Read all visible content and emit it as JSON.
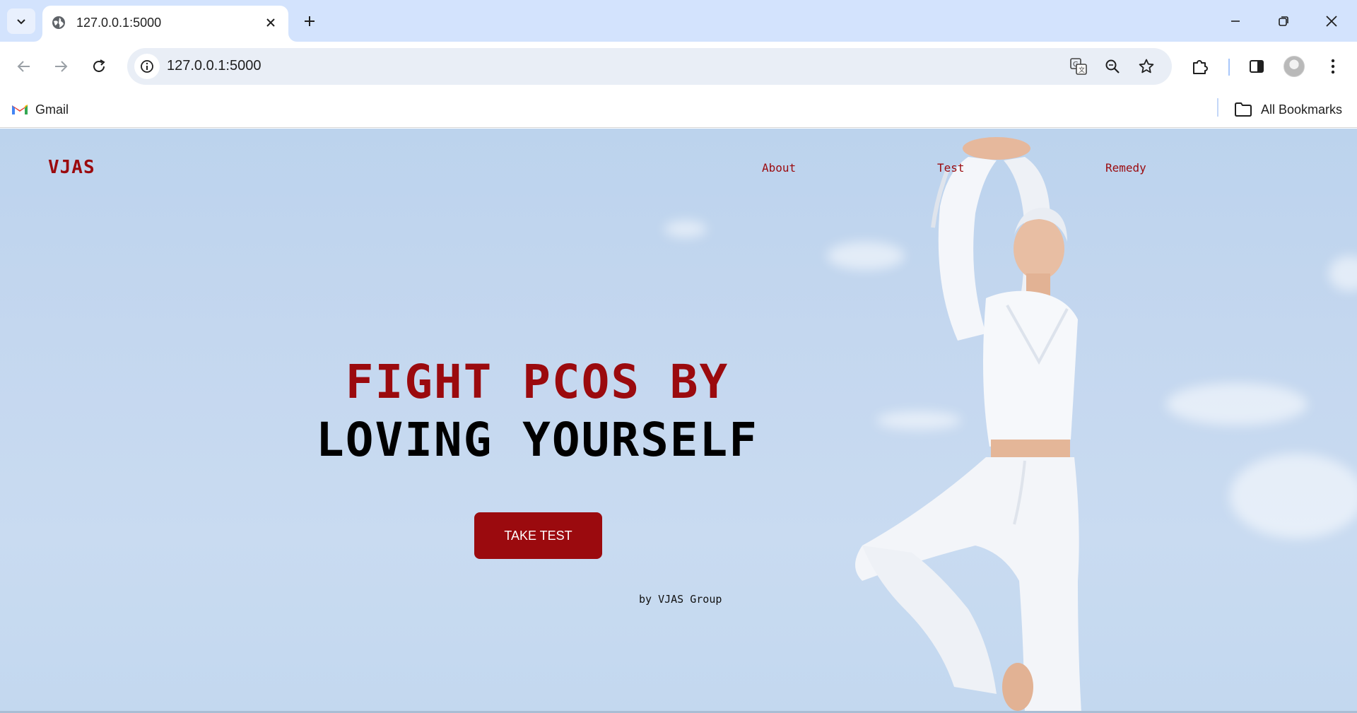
{
  "browser": {
    "tab": {
      "title": "127.0.0.1:5000"
    },
    "omnibox": {
      "url": "127.0.0.1:5000"
    },
    "bookmarks": [
      {
        "label": "Gmail"
      }
    ],
    "all_bookmarks_label": "All Bookmarks"
  },
  "page": {
    "brand": "VJAS",
    "nav": [
      {
        "label": "About"
      },
      {
        "label": "Test"
      },
      {
        "label": "Remedy"
      }
    ],
    "hero": {
      "line1": "FIGHT PCOS BY",
      "line2": "LOVING YOURSELF",
      "cta_label": "TAKE TEST",
      "byline": "by VJAS Group"
    }
  },
  "colors": {
    "accent": "#9b0a0e",
    "sky": "#c4d7ef",
    "tabstrip": "#d3e3fd"
  }
}
